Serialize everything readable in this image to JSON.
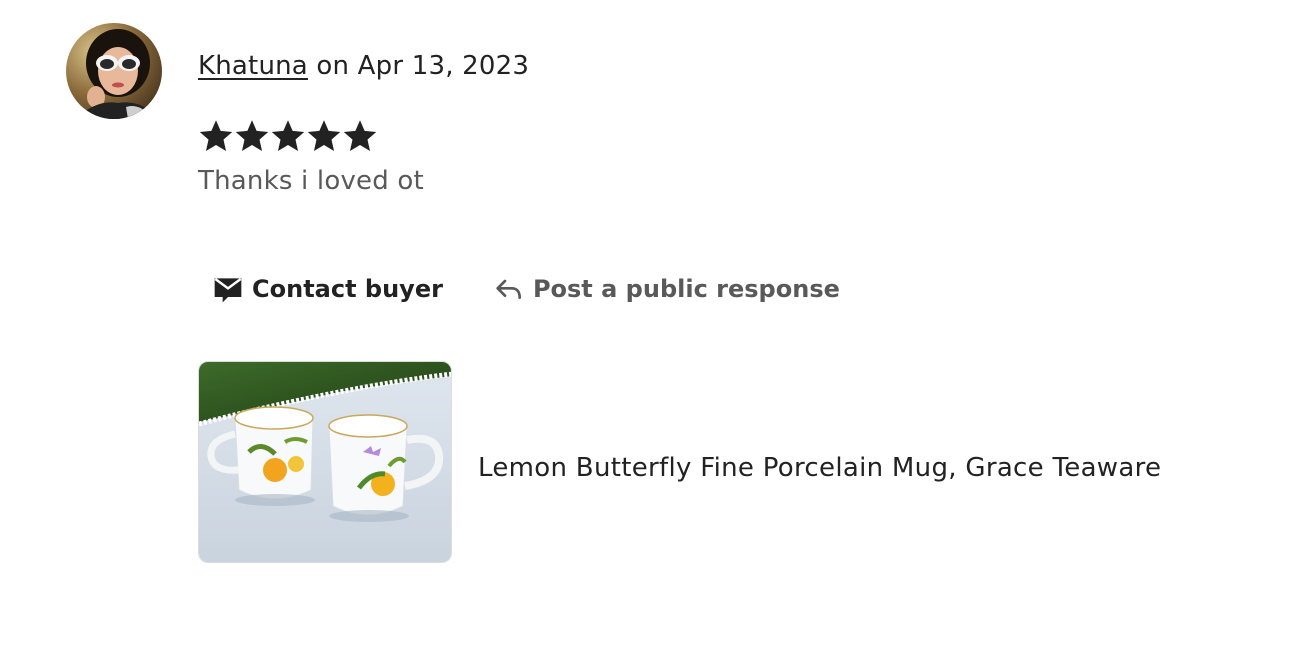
{
  "review": {
    "reviewer_name": "Khatuna",
    "date_text": "on Apr 13, 2023",
    "rating": 5,
    "max_rating": 5,
    "text": "Thanks i loved ot"
  },
  "actions": {
    "contact_label": "Contact buyer",
    "respond_label": "Post a public response"
  },
  "product": {
    "title": "Lemon Butterfly Fine Porcelain Mug, Grace Teaware"
  },
  "colors": {
    "text_primary": "#222222",
    "text_secondary": "#595959",
    "border": "#dddddd"
  },
  "icons": {
    "contact": "envelope-icon",
    "respond": "reply-arrow-icon",
    "star": "star-icon"
  }
}
